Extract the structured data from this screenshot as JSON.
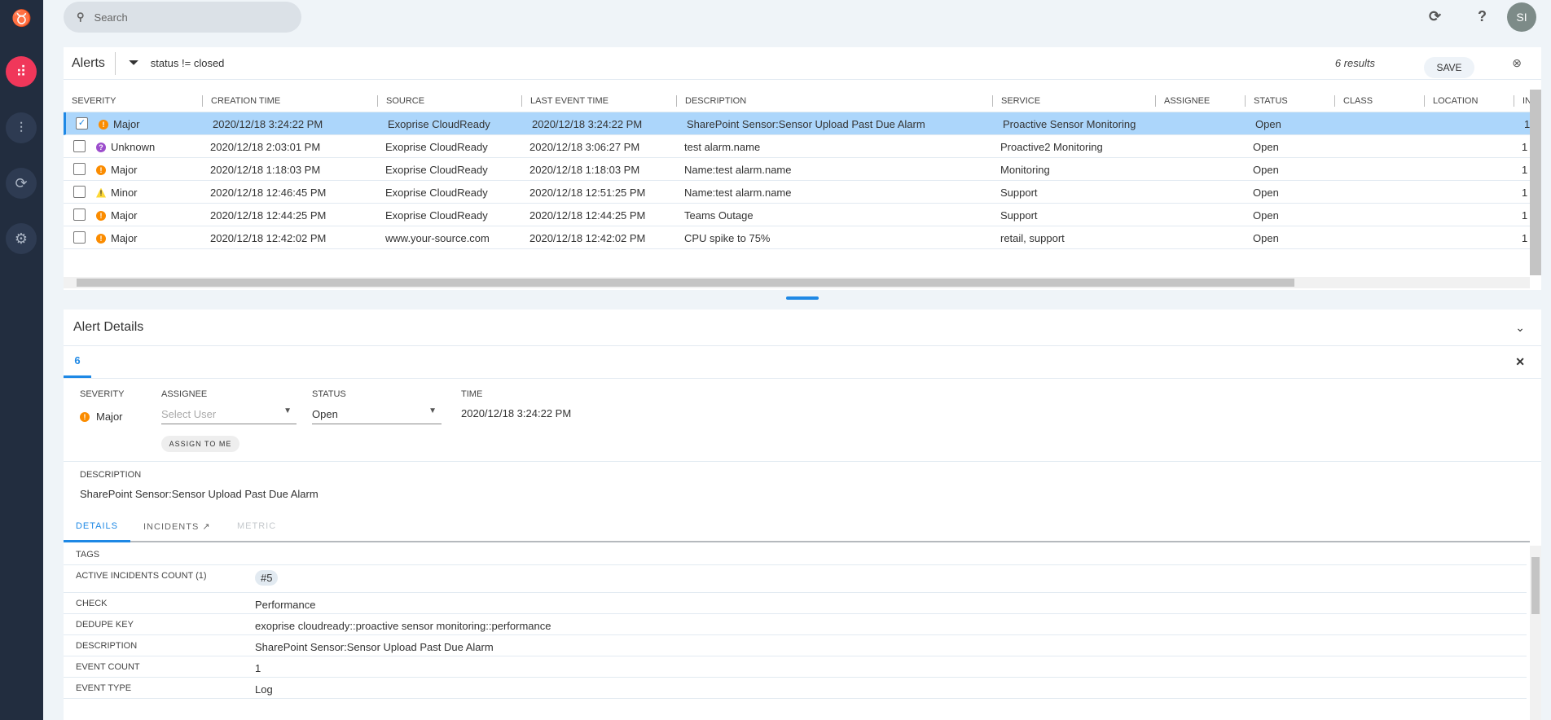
{
  "search": {
    "placeholder": "Search"
  },
  "user": {
    "initials": "SI"
  },
  "alerts": {
    "title": "Alerts",
    "filter": "status != closed",
    "results": "6 results",
    "save": "SAVE",
    "columns": [
      "SEVERITY",
      "CREATION TIME",
      "SOURCE",
      "LAST EVENT TIME",
      "DESCRIPTION",
      "SERVICE",
      "ASSIGNEE",
      "STATUS",
      "CLASS",
      "LOCATION",
      "INC"
    ],
    "rows": [
      {
        "severity": "Major",
        "created": "2020/12/18 3:24:22 PM",
        "source": "Exoprise CloudReady",
        "last": "2020/12/18 3:24:22 PM",
        "description": "SharePoint Sensor:Sensor Upload Past Due Alarm",
        "service": "Proactive Sensor Monitoring",
        "status": "Open",
        "inc": "1"
      },
      {
        "severity": "Unknown",
        "created": "2020/12/18 2:03:01 PM",
        "source": "Exoprise CloudReady",
        "last": "2020/12/18 3:06:27 PM",
        "description": "test alarm.name",
        "service": "Proactive2 Monitoring",
        "status": "Open",
        "inc": "1"
      },
      {
        "severity": "Major",
        "created": "2020/12/18 1:18:03 PM",
        "source": "Exoprise CloudReady",
        "last": "2020/12/18 1:18:03 PM",
        "description": "Name:test alarm.name",
        "service": "Monitoring",
        "status": "Open",
        "inc": "1"
      },
      {
        "severity": "Minor",
        "created": "2020/12/18 12:46:45 PM",
        "source": "Exoprise CloudReady",
        "last": "2020/12/18 12:51:25 PM",
        "description": "Name:test alarm.name",
        "service": "Support",
        "status": "Open",
        "inc": "1"
      },
      {
        "severity": "Major",
        "created": "2020/12/18 12:44:25 PM",
        "source": "Exoprise CloudReady",
        "last": "2020/12/18 12:44:25 PM",
        "description": "Teams Outage",
        "service": "Support",
        "status": "Open",
        "inc": "1"
      },
      {
        "severity": "Major",
        "created": "2020/12/18 12:42:02 PM",
        "source": "www.your-source.com",
        "last": "2020/12/18 12:42:02 PM",
        "description": "CPU spike to 75%",
        "service": "retail, support",
        "status": "Open",
        "inc": "1"
      }
    ]
  },
  "colors": {
    "major": "#fb8c00",
    "unknown": "#9c4dcc",
    "minor": "#fdd835",
    "accent": "#1e88e5",
    "selected": "#acd6fb"
  },
  "details": {
    "title": "Alert Details",
    "tab": "6",
    "severity_label": "SEVERITY",
    "severity": "Major",
    "assignee_label": "ASSIGNEE",
    "assignee_placeholder": "Select User",
    "status_label": "STATUS",
    "status": "Open",
    "time_label": "TIME",
    "time": "2020/12/18 3:24:22 PM",
    "assign_me": "ASSIGN TO ME",
    "description_label": "DESCRIPTION",
    "description": "SharePoint Sensor:Sensor Upload Past Due Alarm",
    "subtabs": [
      "DETAILS",
      "INCIDENTS",
      "METRIC"
    ],
    "fields": [
      {
        "k": "TAGS",
        "v": ""
      },
      {
        "k": "ACTIVE INCIDENTS COUNT (1)",
        "v": "#5"
      },
      {
        "k": "CHECK",
        "v": "Performance"
      },
      {
        "k": "DEDUPE KEY",
        "v": "exoprise cloudready::proactive sensor monitoring::performance"
      },
      {
        "k": "DESCRIPTION",
        "v": "SharePoint Sensor:Sensor Upload Past Due Alarm"
      },
      {
        "k": "EVENT COUNT",
        "v": "1"
      },
      {
        "k": "EVENT TYPE",
        "v": "Log"
      }
    ]
  }
}
